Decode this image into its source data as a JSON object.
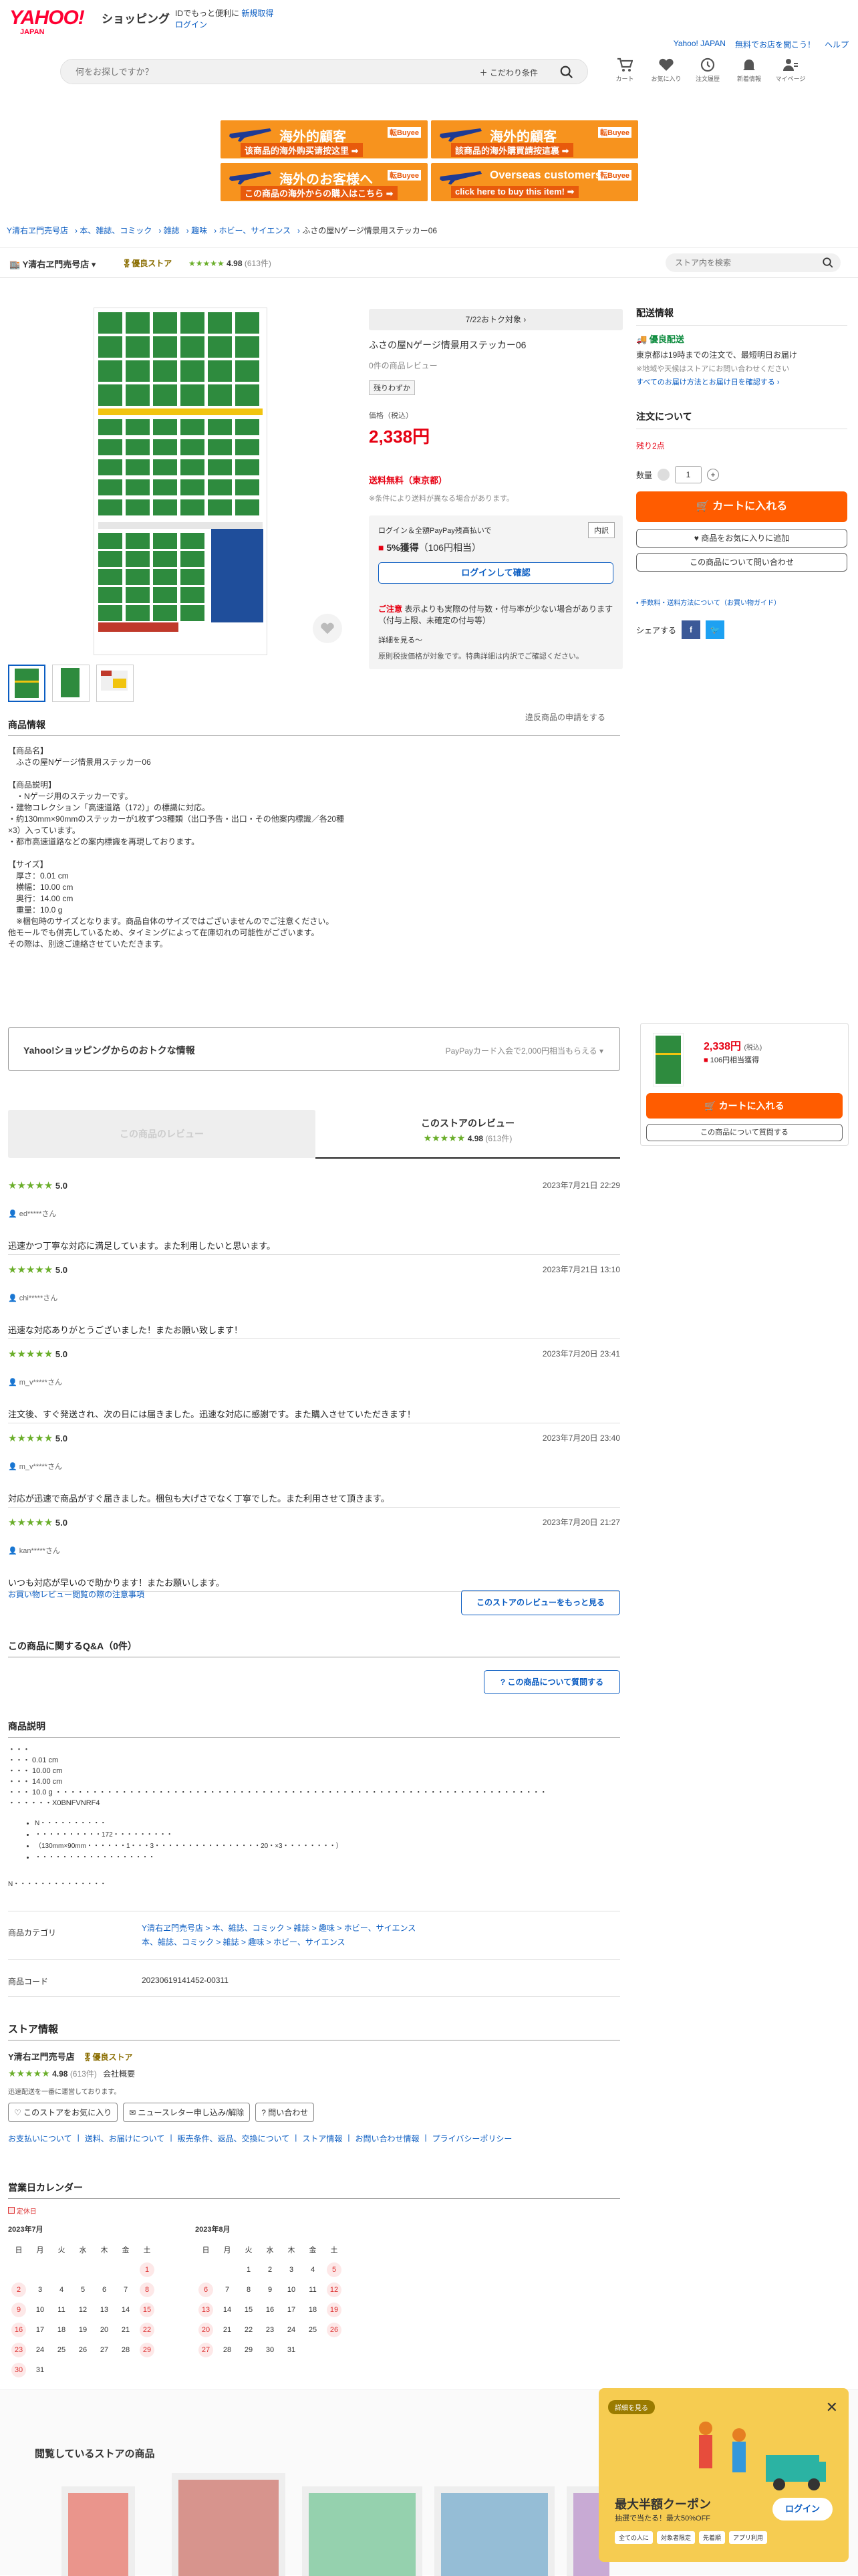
{
  "header": {
    "logo": "YAHOO!",
    "logo_sub": "JAPAN",
    "shopping": "ショッピング",
    "promo_text": "IDでもっと便利に",
    "register": "新規取得",
    "login": "ログイン",
    "links": [
      "Yahoo! JAPAN",
      "無料でお店を開こう！",
      "ヘルプ"
    ],
    "search_placeholder": "何をお探しですか？",
    "conditions": "＋ こだわり条件",
    "icons": [
      "カート",
      "お気に入り",
      "注文履歴",
      "新着情報",
      "マイページ"
    ]
  },
  "banners": [
    {
      "t1": "海外的顧客",
      "t2": "该商品的海外购买请按这里 ➡",
      "badge": "転Buyee"
    },
    {
      "t1": "海外的顧客",
      "t2": "該商品的海外購買請按這裏 ➡",
      "badge": "転Buyee"
    },
    {
      "t1": "海外のお客様へ",
      "t2": "この商品の海外からの購入はこちら ➡",
      "badge": "転Buyee"
    },
    {
      "t1": "Overseas customers,",
      "t2": "click here to buy this item! ➡",
      "badge": "転Buyee"
    }
  ],
  "breadcrumb": [
    "Y清右ヱ門売号店",
    "本、雑誌、コミック",
    "雑誌",
    "趣味",
    "ホビー、サイエンス",
    "ふさの屋Nゲージ情景用ステッカー06"
  ],
  "store": {
    "name": "Y清右ヱ門売号店",
    "badge": "優良ストア",
    "rating": "4.98",
    "count": "(613件)",
    "search_placeholder": "ストア内を検索"
  },
  "product": {
    "promo": "7/22おトク対象 ›",
    "title": "ふさの屋Nゲージ情景用ステッカー06",
    "reviews": "0件の商品レビュー",
    "stock_badge": "残りわずか",
    "price_label": "価格（税込）",
    "price": "2,338円",
    "shipping": "送料無料（東京都）",
    "shipping_note": "※条件により送料が異なる場合があります。",
    "paypay_text": "ログイン＆全額PayPay残高払いで",
    "paypay_point": "5%獲得",
    "paypay_yen": "（106円相当）",
    "inner": "内訳",
    "login_confirm": "ログインして確認",
    "caution_title": "ご注意",
    "caution": "表示よりも実際の付与数・付与率が少ない場合があります（付与上限、未確定の付与等）",
    "details": "詳細を見る〜",
    "details_note": "原則税抜価格が対象です。特典詳細は内訳でご確認ください。",
    "report": "違反商品の申請をする"
  },
  "delivery": {
    "title": "配送情報",
    "fast": "優良配送",
    "line1": "東京都は19時までの注文で、最短明日お届け",
    "line2": "※地域や天候はストアにお問い合わせください",
    "line3": "すべてのお届け方法とお届け日を確認する ›",
    "order_title": "注文について",
    "remaining": "残り2点",
    "qty_label": "数量",
    "qty": "1",
    "cart": "カートに入れる",
    "fav": "商品をお気に入りに追加",
    "ask": "この商品について問い合わせ",
    "info_links": "• 手数料・送料方法について（お買い物ガイド）",
    "share": "シェアする"
  },
  "info": {
    "title": "商品情報",
    "lines": [
      "【商品名】",
      "　ふさの屋Nゲージ情景用ステッカー06",
      "",
      "【商品説明】",
      "　・Nゲージ用のステッカーです。",
      "・建物コレクション「高速道路（172）」の標識に対応。",
      "・約130mm×90mmのステッカーが1枚ずつ3種類（出口予告・出口・その他案内標識／各20種×3）入っています。",
      "・都市高速道路などの案内標識を再現しております。",
      "",
      "【サイズ】",
      "　厚さ：0.01 cm",
      "　横幅：10.00 cm",
      "　奥行：14.00 cm",
      "　重量：10.0 g",
      "　※梱包時のサイズとなります。商品自体のサイズではございませんのでご注意ください。",
      "他モールでも併売しているため、タイミングによって在庫切れの可能性がございます。",
      "その際は、別途ご連絡させていただきます。"
    ]
  },
  "deals": {
    "title": "Yahoo!ショッピングからのおトクな情報",
    "right": "PayPayカード入会で2,000円相当もらえる ▾"
  },
  "side_mini": {
    "price": "2,338円",
    "tax": "(税込)",
    "point": "106円相当獲得",
    "cart": "カートに入れる",
    "ask": "この商品について質問する"
  },
  "reviews": {
    "product_tab": "この商品のレビュー",
    "store_title": "このストアのレビュー",
    "rating": "4.98",
    "count": "(613件)",
    "items": [
      {
        "score": "5.0",
        "date": "2023年7月21日 22:29",
        "user": "ed*****さん",
        "body": "迅速かつ丁寧な対応に満足しています。また利用したいと思います。"
      },
      {
        "score": "5.0",
        "date": "2023年7月21日 13:10",
        "user": "chi*****さん",
        "body": "迅速な対応ありがとうございました！またお願い致します！"
      },
      {
        "score": "5.0",
        "date": "2023年7月20日 23:41",
        "user": "m_v*****さん",
        "body": "注文後、すぐ発送され、次の日には届きました。迅速な対応に感謝です。また購入させていただきます！"
      },
      {
        "score": "5.0",
        "date": "2023年7月20日 23:40",
        "user": "m_v*****さん",
        "body": "対応が迅速で商品がすぐ届きました。梱包も大げさでなく丁寧でした。また利用させて頂きます。"
      },
      {
        "score": "5.0",
        "date": "2023年7月20日 21:27",
        "user": "kan*****さん",
        "body": "いつも対応が早いので助かります！またお願いします。"
      }
    ],
    "help_link": "お買い物レビュー閲覧の際の注意事項",
    "more": "このストアのレビューをもっと見る"
  },
  "qa": {
    "title": "この商品に関するQ&A（0件）",
    "ask": "? この商品について質問する"
  },
  "desc": {
    "title": "商品説明",
    "lines": [
      "・・・",
      "・・・ 0.01 cm",
      "・・・ 10.00 cm",
      "・・・ 14.00 cm",
      "・・・ 10.0 g ・・・・・・・・・・・・・・・・・・・・・・・・・・・・・・・・・・・・・・・・・・・・・・・・・・・・・・・・・・・・・・・・・・・",
      "・・・・・・X0BNFVNRF4"
    ],
    "bullets": [
      "N・・・・・・・・・・",
      "・・・・・・・・・・172・・・・・・・・・",
      "（130mm×90mm・・・・・・1・・・3・・・・・・・・・・・・・・・・20・×3・・・・・・・・）",
      "・・・・・・・・・・・・・・・・・・"
    ],
    "tail": "N・・・・・・・・・・・・・・"
  },
  "category": {
    "label": "商品カテゴリ",
    "line1": "Y清右ヱ門売号店 > 本、雑誌、コミック > 雑誌 > 趣味 > ホビー、サイエンス",
    "line2": "本、雑誌、コミック > 雑誌 > 趣味 > ホビー、サイエンス",
    "code_label": "商品コード",
    "code": "20230619141452-00311"
  },
  "storeinfo": {
    "title": "ストア情報",
    "name": "Y清右ヱ門売号店",
    "badge": "優良ストア",
    "rating": "4.98",
    "count": "(613件)",
    "company": "会社概要",
    "note": "迅速配送を一番に運営しております。",
    "btn1": "♡ このストアをお気に入り",
    "btn2": "ニュースレター申し込み/解除",
    "btn3": "問い合わせ",
    "links": [
      "お支払いについて",
      "送料、お届けについて",
      "販売条件、返品、交換について",
      "ストア情報",
      "お問い合わせ情報",
      "プライバシーポリシー"
    ]
  },
  "calendar": {
    "title": "営業日カレンダー",
    "legend": "定休日",
    "weekdays": [
      "日",
      "月",
      "火",
      "水",
      "木",
      "金",
      "土"
    ],
    "m1": {
      "name": "2023年7月",
      "rows": [
        [
          "",
          "",
          "",
          "",
          "",
          "",
          "1"
        ],
        [
          "2",
          "3",
          "4",
          "5",
          "6",
          "7",
          "8"
        ],
        [
          "9",
          "10",
          "11",
          "12",
          "13",
          "14",
          "15"
        ],
        [
          "16",
          "17",
          "18",
          "19",
          "20",
          "21",
          "22"
        ],
        [
          "23",
          "24",
          "25",
          "26",
          "27",
          "28",
          "29"
        ],
        [
          "30",
          "31",
          "",
          "",
          "",
          "",
          ""
        ]
      ]
    },
    "m2": {
      "name": "2023年8月",
      "rows": [
        [
          "",
          "",
          "1",
          "2",
          "3",
          "4",
          "5"
        ],
        [
          "6",
          "7",
          "8",
          "9",
          "10",
          "11",
          "12"
        ],
        [
          "13",
          "14",
          "15",
          "16",
          "17",
          "18",
          "19"
        ],
        [
          "20",
          "21",
          "22",
          "23",
          "24",
          "25",
          "26"
        ],
        [
          "27",
          "28",
          "29",
          "30",
          "31",
          "",
          ""
        ]
      ]
    }
  },
  "recent": {
    "title": "閲覧しているストアの商品"
  },
  "popup": {
    "tag": "詳細を見る",
    "title": "最大半額クーポン",
    "sub": "抽選で当たる！最大50%OFF",
    "login": "ログイン",
    "chips": [
      "全ての人に",
      "対象者限定",
      "先着順",
      "アプリ利用"
    ]
  }
}
